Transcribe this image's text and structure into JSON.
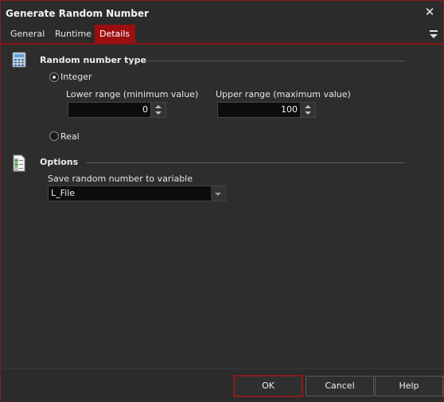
{
  "window": {
    "title": "Generate Random Number",
    "close_glyph": "✕"
  },
  "tabs": [
    {
      "label": "General"
    },
    {
      "label": "Runtime"
    },
    {
      "label": "Details",
      "active": true
    }
  ],
  "random_type": {
    "title": "Random number type",
    "integer_label": "Integer",
    "integer_selected": true,
    "lower_label": "Lower range (minimum value)",
    "lower_value": "0",
    "upper_label": "Upper range (maximum value)",
    "upper_value": "100",
    "real_label": "Real",
    "real_selected": false
  },
  "options": {
    "title": "Options",
    "save_label": "Save random number to variable",
    "variable_value": "L_File"
  },
  "buttons": {
    "ok": "OK",
    "cancel": "Cancel",
    "help": "Help"
  },
  "colors": {
    "accent": "#9b0f0f",
    "border": "#8a1c1c",
    "background": "#2d2d2d"
  },
  "icons": {
    "calculator": "calculator-icon",
    "checklist": "checklist-icon",
    "menu": "menu-icon"
  }
}
